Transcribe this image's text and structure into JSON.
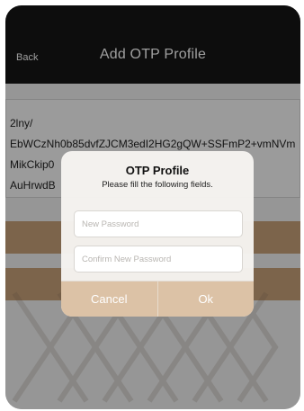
{
  "navbar": {
    "back_label": "Back",
    "title": "Add OTP Profile"
  },
  "content": {
    "text_lines": [
      "2lny/",
      "EbWCzNh0b85dvfZJCM3edI2HG2gQW+SSFmP2+vmNVm",
      "MikCkip0",
      "AuHrwdB"
    ]
  },
  "alert": {
    "title": "OTP Profile",
    "message": "Please fill the following fields.",
    "new_password_placeholder": "New Password",
    "confirm_password_placeholder": "Confirm New Password",
    "cancel_label": "Cancel",
    "ok_label": "Ok"
  },
  "colors": {
    "navbar": "#151515",
    "accent_gold": "#c9a27a",
    "alert_button": "#dcc2a6"
  }
}
